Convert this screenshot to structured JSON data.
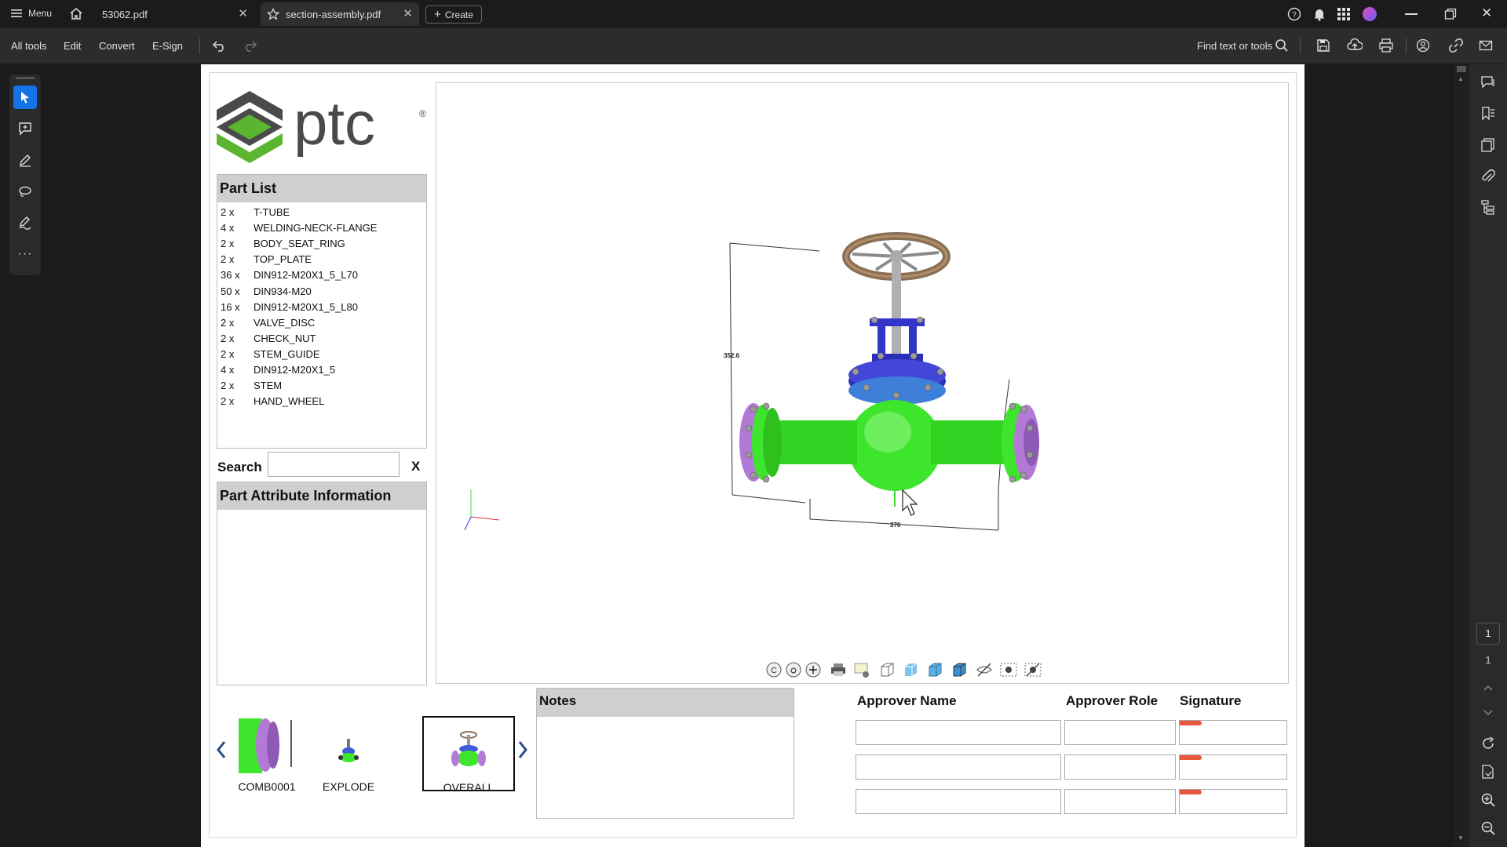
{
  "titlebar": {
    "menu_label": "Menu",
    "tabs": [
      {
        "label": "53062.pdf"
      },
      {
        "label": "section-assembly.pdf"
      }
    ],
    "create_label": "Create"
  },
  "toolbar": {
    "items": [
      "All tools",
      "Edit",
      "Convert",
      "E-Sign"
    ],
    "find_label": "Find text or tools"
  },
  "document": {
    "logo_text": "ptc",
    "logo_reg": "®",
    "part_list_title": "Part List",
    "parts": [
      {
        "qty": "2 x",
        "name": "T-TUBE"
      },
      {
        "qty": "4 x",
        "name": "WELDING-NECK-FLANGE"
      },
      {
        "qty": "2 x",
        "name": "BODY_SEAT_RING"
      },
      {
        "qty": "2 x",
        "name": "TOP_PLATE"
      },
      {
        "qty": "36 x",
        "name": "DIN912-M20X1_5_L70"
      },
      {
        "qty": "50 x",
        "name": "DIN934-M20"
      },
      {
        "qty": "16 x",
        "name": "DIN912-M20X1_5_L80"
      },
      {
        "qty": "2 x",
        "name": "VALVE_DISC"
      },
      {
        "qty": "2 x",
        "name": "CHECK_NUT"
      },
      {
        "qty": "2 x",
        "name": "STEM_GUIDE"
      },
      {
        "qty": "4 x",
        "name": "DIN912-M20X1_5"
      },
      {
        "qty": "2 x",
        "name": "STEM"
      },
      {
        "qty": "2 x",
        "name": "HAND_WHEEL"
      }
    ],
    "search_label": "Search",
    "search_value": "",
    "search_clear": "X",
    "attr_title": "Part Attribute Information",
    "views": [
      {
        "label": "COMB0001"
      },
      {
        "label": "EXPLODE"
      },
      {
        "label": "OVERALL"
      }
    ],
    "notes_title": "Notes",
    "approver_name_header": "Approver Name",
    "approver_role_header": "Approver Role",
    "signature_header": "Signature",
    "accent_orange": "#e8573c",
    "valve_green": "#38e22a",
    "valve_blue": "#2b2fb8",
    "valve_purple": "#b27ad6"
  },
  "rightrail": {
    "page_current": "1",
    "page_total": "1"
  }
}
